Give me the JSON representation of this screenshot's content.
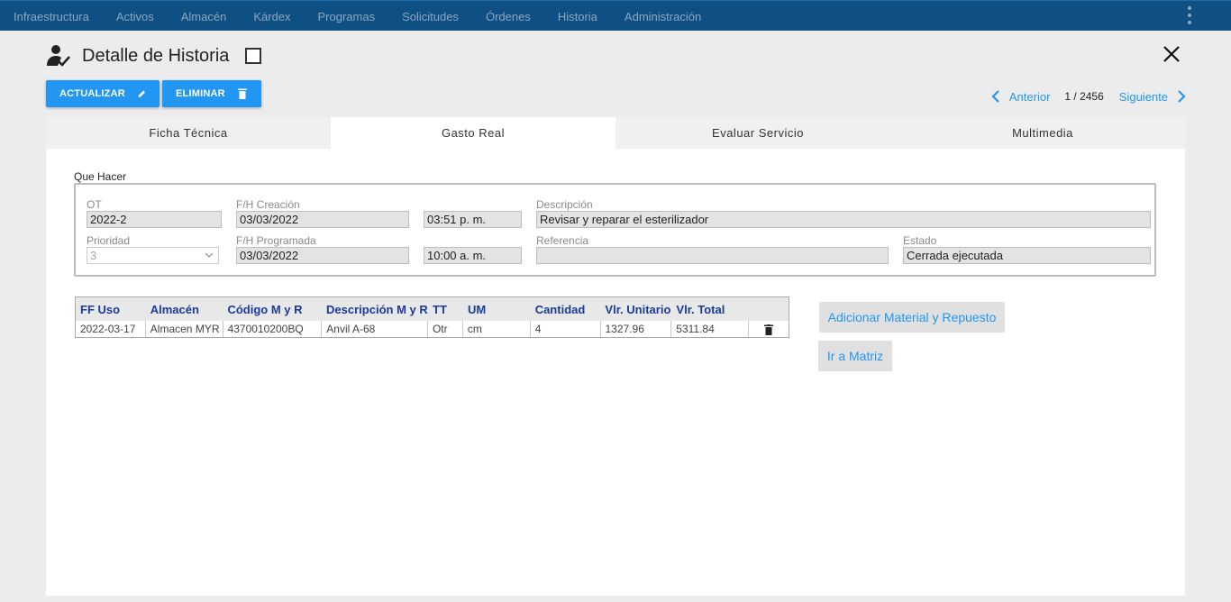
{
  "nav": {
    "items": [
      "Infraestructura",
      "Activos",
      "Almacén",
      "Kárdex",
      "Programas",
      "Solicitudes",
      "Órdenes",
      "Historia",
      "Administración"
    ],
    "more_icon": "more-vert-icon"
  },
  "header": {
    "title": "Detalle de Historia",
    "icon": "user-check-icon",
    "close_icon": "close-icon"
  },
  "actions": {
    "update_label": "ACTUALIZAR",
    "delete_label": "ELIMINAR"
  },
  "pager": {
    "prev_label": "Anterior",
    "count": "1 / 2456",
    "next_label": "Siguiente"
  },
  "tabs": [
    {
      "label": "Ficha Técnica",
      "active": false
    },
    {
      "label": "Gasto Real",
      "active": true
    },
    {
      "label": "Evaluar Servicio",
      "active": false
    },
    {
      "label": "Multimedia",
      "active": false
    }
  ],
  "que_hacer": {
    "section_label": "Que Hacer",
    "ot": {
      "label": "OT",
      "value": "2022-2"
    },
    "fh_creacion": {
      "label": "F/H Creación",
      "date": "03/03/2022",
      "time": "03:51 p. m."
    },
    "descripcion": {
      "label": "Descripción",
      "value": "Revisar y reparar el esterilizador"
    },
    "prioridad": {
      "label": "Prioridad",
      "value": "3"
    },
    "fh_programada": {
      "label": "F/H Programada",
      "date": "03/03/2022",
      "time": "10:00 a. m."
    },
    "referencia": {
      "label": "Referencia",
      "value": ""
    },
    "estado": {
      "label": "Estado",
      "value": "Cerrada ejecutada"
    }
  },
  "grid": {
    "columns": [
      "FF Uso",
      "Almacén",
      "Código M y R",
      "Descripción M y R",
      "TT",
      "UM",
      "Cantidad",
      "Vlr. Unitario",
      "Vlr. Total"
    ],
    "rows": [
      {
        "ff_uso": "2022-03-17",
        "almacen": "Almacen MYR",
        "codigo": "4370010200BQ",
        "descripcion": "Anvil A-68",
        "tt": "Otr",
        "um": "cm",
        "cantidad": "4",
        "vlr_unitario": "1327.96",
        "vlr_total": "5311.84"
      }
    ]
  },
  "side_buttons": {
    "add_label": "Adicionar Material y Repuesto",
    "matrix_label": "Ir a Matriz"
  },
  "colors": {
    "topbar": "#0e4f84",
    "primary": "#2196f3",
    "grid_header_text": "#1a3a9e"
  }
}
